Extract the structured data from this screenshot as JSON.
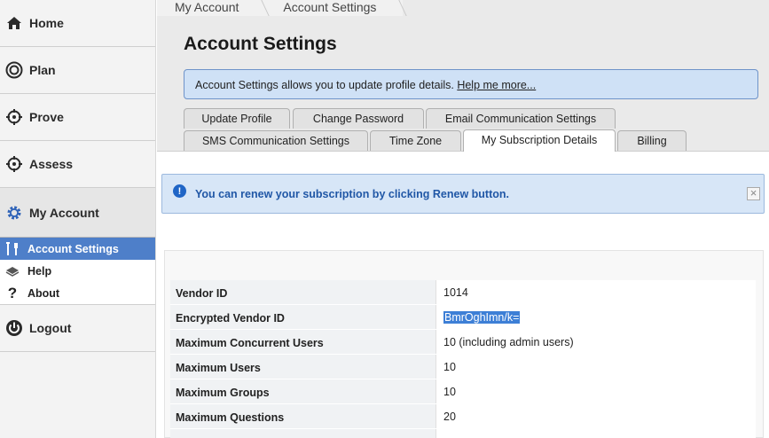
{
  "sidebar": {
    "items": [
      {
        "label": "Home",
        "icon": "home-icon"
      },
      {
        "label": "Plan",
        "icon": "target-icon"
      },
      {
        "label": "Prove",
        "icon": "crosshair-icon"
      },
      {
        "label": "Assess",
        "icon": "crosshair-icon"
      },
      {
        "label": "My Account",
        "icon": "gear-icon"
      }
    ],
    "sub_items": [
      {
        "label": "Account Settings",
        "icon": "tools-icon",
        "selected": true
      },
      {
        "label": "Help",
        "icon": "book-icon"
      },
      {
        "label": "About",
        "icon": "question-icon"
      }
    ],
    "logout": {
      "label": "Logout",
      "icon": "power-icon"
    }
  },
  "breadcrumb": [
    "My Account",
    "Account Settings"
  ],
  "page_title": "Account Settings",
  "info": {
    "text": "Account Settings allows you to update profile details. ",
    "link": "Help me more..."
  },
  "tabs": {
    "row1": [
      "Update Profile",
      "Change Password",
      "Email Communication Settings"
    ],
    "row2": [
      "SMS Communication Settings",
      "Time Zone",
      "My Subscription Details",
      "Billing"
    ],
    "active": "My Subscription Details"
  },
  "notice": {
    "text": "You can renew your subscription by clicking Renew button.",
    "close": "×"
  },
  "details": [
    {
      "label": "Vendor ID",
      "value": "1014"
    },
    {
      "label": "Encrypted Vendor ID",
      "value": "BmrOghImn/k="
    },
    {
      "label": "Maximum Concurrent Users",
      "value": "10 (including admin users)"
    },
    {
      "label": "Maximum Users",
      "value": "10"
    },
    {
      "label": "Maximum Groups",
      "value": "10"
    },
    {
      "label": "Maximum Questions",
      "value": "20"
    }
  ],
  "colors": {
    "accent": "#4e7fc9",
    "info_bg": "#cfe1f6",
    "notice_text": "#2057a6"
  }
}
